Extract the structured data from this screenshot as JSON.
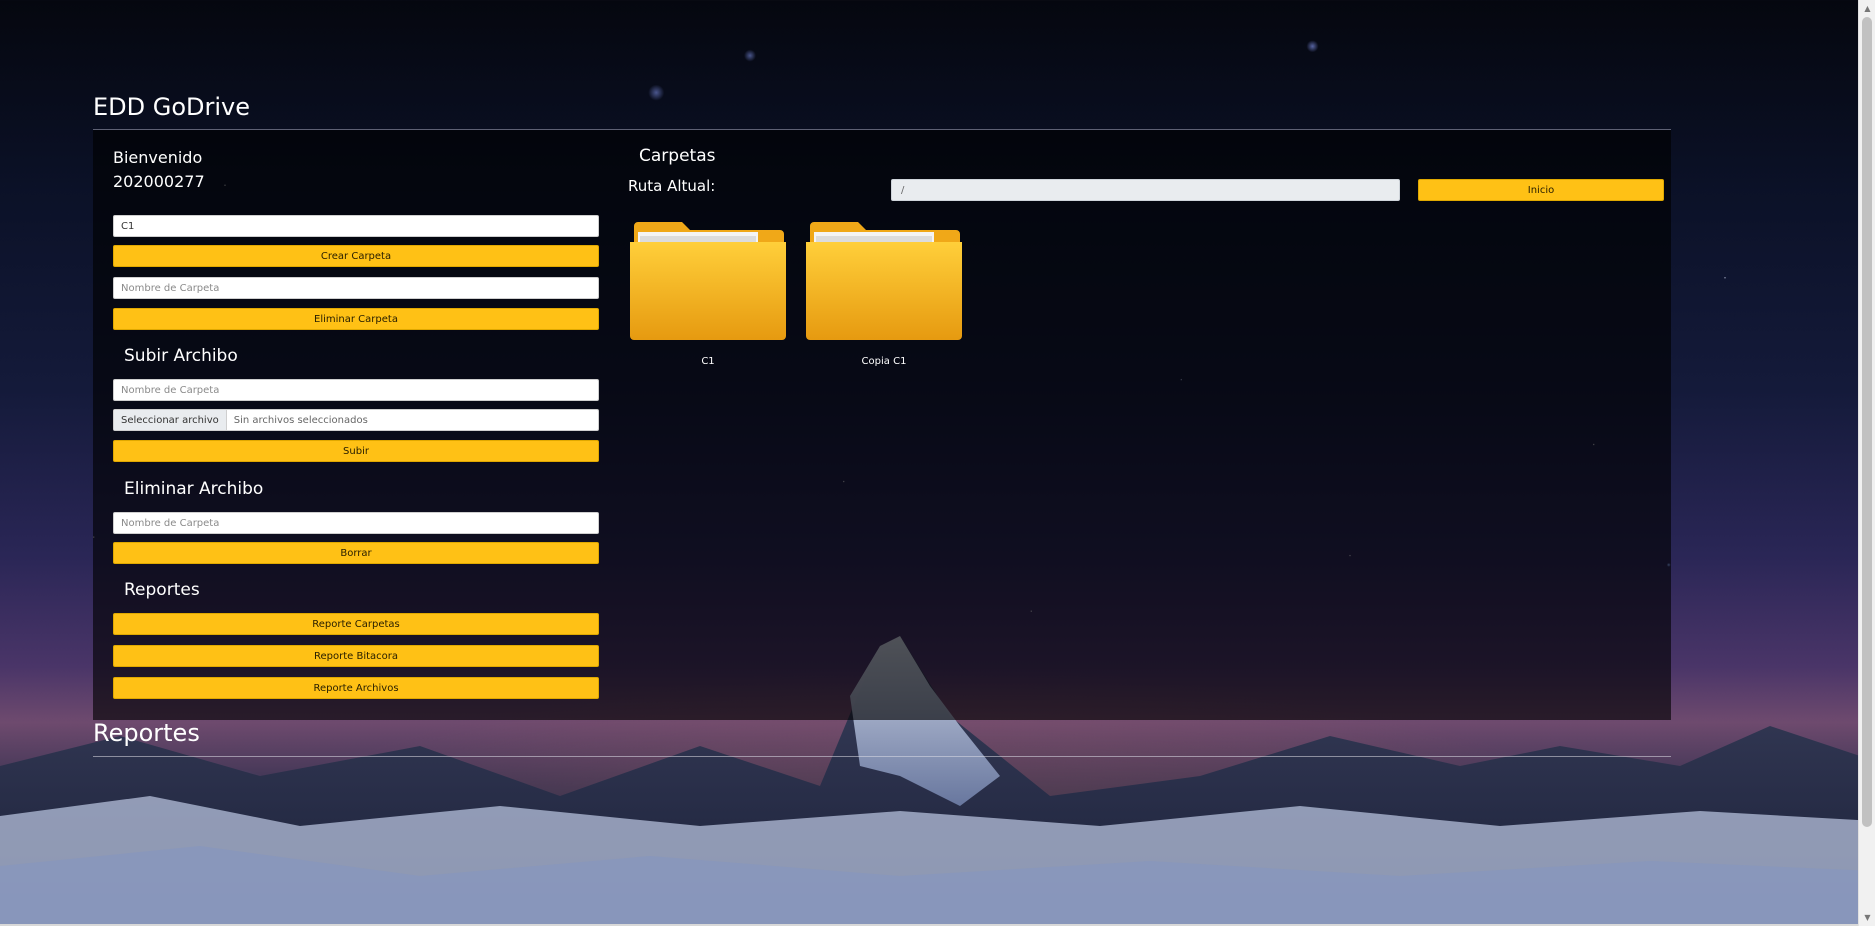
{
  "app": {
    "title": "EDD GoDrive"
  },
  "sidebar": {
    "welcome_label": "Bienvenido",
    "user_id": "202000277",
    "create_folder": {
      "value": "C1",
      "button": "Crear Carpeta"
    },
    "delete_folder": {
      "placeholder": "Nombre de Carpeta",
      "button": "Eliminar Carpeta"
    },
    "upload": {
      "heading": "Subir Archibo",
      "folder_placeholder": "Nombre de Carpeta",
      "file_button": "Seleccionar archivo",
      "file_status": "Sin archivos seleccionados",
      "button": "Subir"
    },
    "delete_file": {
      "heading": "Eliminar Archibo",
      "placeholder": "Nombre de Carpeta",
      "button": "Borrar"
    },
    "reports": {
      "heading": "Reportes",
      "buttons": [
        "Reporte Carpetas",
        "Reporte Bitacora",
        "Reporte Archivos"
      ]
    }
  },
  "main": {
    "heading": "Carpetas",
    "route_label": "Ruta Altual:",
    "route_value": "/",
    "home_button": "Inicio",
    "folders": [
      {
        "label": "C1",
        "icon": "folder-icon"
      },
      {
        "label": "Copia C1",
        "icon": "folder-icon"
      }
    ]
  },
  "footer": {
    "reports_title": "Reportes"
  },
  "colors": {
    "accent": "#ffc115",
    "panel": "rgba(0,0,0,0.62)"
  }
}
